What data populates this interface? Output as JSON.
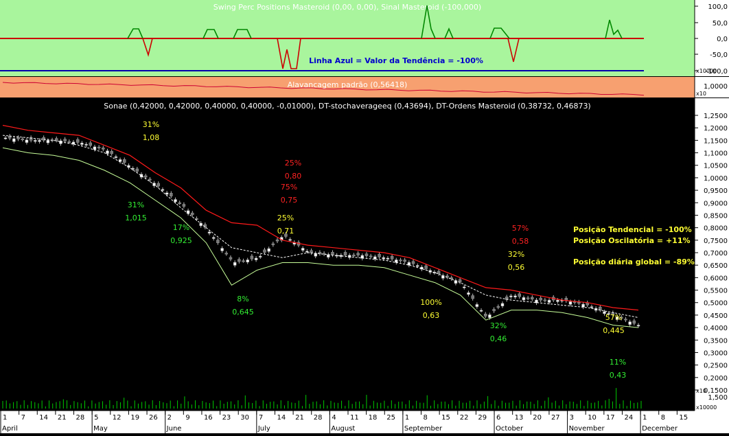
{
  "colors": {
    "top_panel_bg": "#a9f59d",
    "lev_panel_bg": "#f7a070",
    "main_bg": "#000000",
    "axis_bg": "#ffffff",
    "swing_line": "#cc0000",
    "signal_line": "#008800",
    "blue_line": "#0000aa",
    "price_upper": "#ff1a1a",
    "price_lower": "#c8ff9a",
    "yellow_text": "#ffff33",
    "green_text": "#33ee33",
    "red_text": "#ff2222",
    "volume_bar": "#00cc00"
  },
  "top_panel": {
    "title": "Swing Perc Positions Masteroid (0,00, 0,00), Sinal Masteroid (-100,000)",
    "note": "Linha Azul = Valor da Tendência = -100%",
    "y_ticks": [
      "100,0",
      "50,0",
      "0,0",
      "-50,0",
      "-100,0"
    ],
    "multiplier": "x10000"
  },
  "leverage_panel": {
    "title": "Alavancagem padrão (0,56418)",
    "y_tick": "1,0000",
    "multiplier": "x10"
  },
  "main_panel": {
    "title": "Sonae (0,42000, 0,42000, 0,40000, 0,40000, -0,01000), DT-stochaverageeq (0,43694), DT-Ordens Masteroid (0,38732, 0,46873)",
    "y_ticks": [
      "1,2500",
      "1,2000",
      "1,1500",
      "1,1000",
      "1,0500",
      "1,0000",
      "0,9500",
      "0,9000",
      "0,8500",
      "0,8000",
      "0,7500",
      "0,7000",
      "0,6500",
      "0,6000",
      "0,5500",
      "0,5000",
      "0,4500",
      "0,4000",
      "0,3500",
      "0,3000",
      "0,2500",
      "0,2000",
      "0,1500"
    ],
    "info_lines": [
      "Posição Tendencial = -100%",
      "Posição Oscilatória = +11%",
      "Posição diária global = -89%"
    ]
  },
  "annotations": [
    {
      "pct": "31%",
      "val": "1,08",
      "color": "yellow"
    },
    {
      "pct": "31%",
      "val": "1,015",
      "color": "green"
    },
    {
      "pct": "17%",
      "val": "0,925",
      "color": "green"
    },
    {
      "pct": "25%",
      "val": "0,80",
      "color": "red"
    },
    {
      "pct": "75%",
      "val": "0,75",
      "color": "red"
    },
    {
      "pct": "25%",
      "val": "0,71",
      "color": "yellow"
    },
    {
      "pct": "8%",
      "val": "0,645",
      "color": "green"
    },
    {
      "pct": "100%",
      "val": "0,63",
      "color": "yellow"
    },
    {
      "pct": "57%",
      "val": "0,58",
      "color": "red"
    },
    {
      "pct": "32%",
      "val": "0,56",
      "color": "yellow"
    },
    {
      "pct": "32%",
      "val": "0,46",
      "color": "green"
    },
    {
      "pct": "57%",
      "val": "0,445",
      "color": "yellow"
    },
    {
      "pct": "11%",
      "val": "0,43",
      "color": "green"
    }
  ],
  "volume_panel": {
    "multiplier": "x10",
    "y_tick": "1,500",
    "multiplier_bottom": "x10000"
  },
  "x_axis": {
    "days": [
      "1",
      "7",
      "14",
      "21",
      "28",
      "5",
      "12",
      "19",
      "26",
      "2",
      "9",
      "16",
      "23",
      "30",
      "7",
      "14",
      "21",
      "28",
      "4",
      "11",
      "18",
      "25",
      "1",
      "8",
      "15",
      "22",
      "29",
      "6",
      "13",
      "20",
      "27",
      "3",
      "10",
      "17",
      "24",
      "1",
      "8",
      "15"
    ],
    "months": [
      "April",
      "May",
      "June",
      "July",
      "August",
      "September",
      "October",
      "November",
      "December"
    ]
  },
  "chart_data": {
    "type": "candlestick",
    "title": "Sonae (0,42000, 0,42000, 0,40000, 0,40000, -0,01000)",
    "ylim": [
      0.13,
      1.28
    ],
    "series": [
      {
        "name": "DT-stochaverageeq",
        "values_approx": [
          1.17,
          1.16,
          1.15,
          1.13,
          1.1,
          1.04,
          0.97,
          0.88,
          0.8,
          0.72,
          0.7,
          0.68,
          0.7,
          0.69,
          0.68,
          0.67,
          0.65,
          0.62,
          0.58,
          0.53,
          0.51,
          0.5,
          0.49,
          0.48,
          0.46,
          0.44
        ]
      },
      {
        "name": "DT-Ordens Masteroid upper",
        "values_approx": [
          1.21,
          1.19,
          1.18,
          1.17,
          1.13,
          1.09,
          1.02,
          0.96,
          0.87,
          0.82,
          0.81,
          0.75,
          0.73,
          0.72,
          0.71,
          0.7,
          0.68,
          0.64,
          0.6,
          0.56,
          0.55,
          0.53,
          0.51,
          0.5,
          0.48,
          0.47
        ]
      },
      {
        "name": "DT-Ordens Masteroid lower",
        "values_approx": [
          1.12,
          1.1,
          1.09,
          1.07,
          1.03,
          0.98,
          0.91,
          0.84,
          0.74,
          0.57,
          0.63,
          0.66,
          0.66,
          0.65,
          0.65,
          0.64,
          0.61,
          0.58,
          0.53,
          0.43,
          0.47,
          0.47,
          0.46,
          0.44,
          0.41,
          0.4
        ]
      }
    ],
    "close_approx": [
      1.16,
      1.15,
      1.15,
      1.14,
      1.11,
      1.04,
      0.97,
      0.89,
      0.79,
      0.66,
      0.68,
      0.77,
      0.7,
      0.69,
      0.69,
      0.68,
      0.66,
      0.62,
      0.58,
      0.44,
      0.53,
      0.51,
      0.51,
      0.49,
      0.45,
      0.41
    ]
  }
}
